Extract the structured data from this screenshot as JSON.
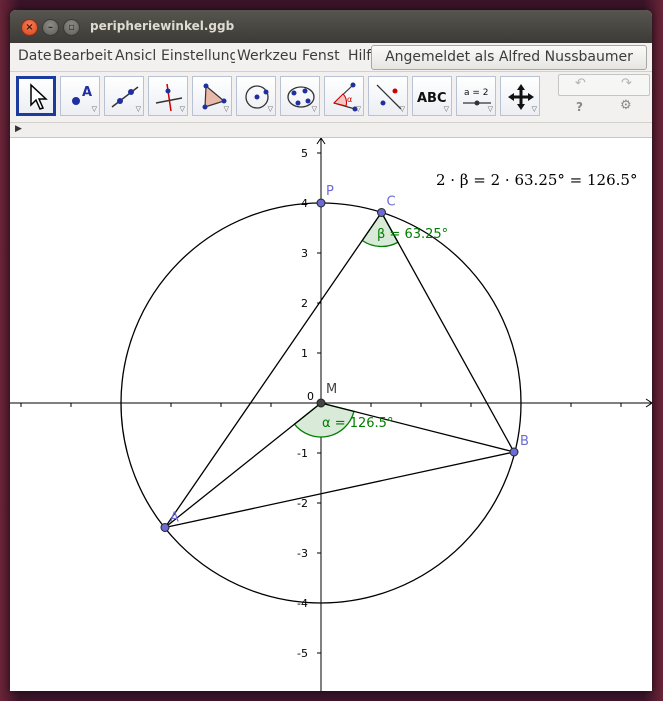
{
  "window": {
    "title": "peripheriewinkel.ggb"
  },
  "menu": {
    "items": [
      "Datei",
      "Bearbeiten",
      "Ansicht",
      "Einstellungen",
      "Werkzeuge",
      "Fenster",
      "Hilfe"
    ],
    "visible": [
      "Date",
      "Bearbeit",
      "Ansicl",
      "Einstellung",
      "Werkzeu",
      "Fenst",
      "Hilfe"
    ],
    "login": "Angemeldet als Alfred Nussbaumer"
  },
  "toolbar": {
    "tools": [
      "move-tool",
      "point-tool",
      "line-tool",
      "perpendicular-tool",
      "polygon-tool",
      "circle-tool",
      "conic-tool",
      "angle-tool",
      "reflect-tool",
      "text-tool",
      "slider-tool",
      "move-view-tool"
    ],
    "text_tool_label": "ABC",
    "slider_tool_label": "a = 2",
    "undo": "↶",
    "redo": "↷",
    "help": "?",
    "settings": "⚙"
  },
  "graphics": {
    "formula": "2 · β = 2 · 63.25° = 126.5°",
    "points": {
      "P": {
        "label": "P",
        "x": 0,
        "y": 4
      },
      "C": {
        "label": "C",
        "x": 1.21,
        "y": 3.81
      },
      "M": {
        "label": "M",
        "x": 0,
        "y": 0
      },
      "B": {
        "label": "B",
        "x": 3.86,
        "y": -0.98
      },
      "A": {
        "label": "A",
        "x": -3.12,
        "y": -2.49
      }
    },
    "angle_beta": "β = 63.25°",
    "angle_alpha": "α = 126.5°",
    "origin_label": "0",
    "x_ticks": [],
    "y_ticks": [
      "5",
      "4",
      "3",
      "2",
      "1",
      "-1",
      "-2",
      "-3",
      "-4",
      "-5"
    ],
    "colors": {
      "point": "#6b6bd6",
      "angle": "#007f00",
      "angle_fill": "#d9ead9",
      "line": "#000000"
    }
  }
}
